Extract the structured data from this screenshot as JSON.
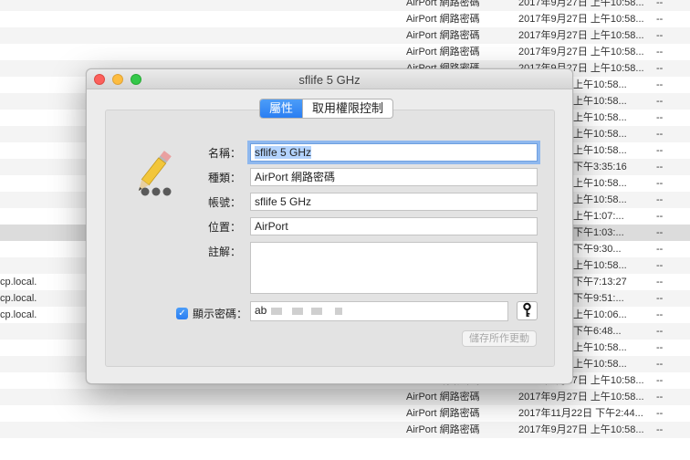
{
  "window": {
    "title": "sflife 5 GHz",
    "tabs": [
      "屬性",
      "取用權限控制"
    ],
    "labels": {
      "name": "名稱：",
      "kind": "種類：",
      "account": "帳號：",
      "where": "位置：",
      "comments": "註解："
    },
    "fields": {
      "name": "sflife 5 GHz",
      "kind": "AirPort 網路密碼",
      "account": "sflife 5 GHz",
      "where": "AirPort",
      "comments": ""
    },
    "show_password": {
      "label": "顯示密碼：",
      "checked": true,
      "check_glyph": "✓"
    },
    "password_visible": "ab",
    "save_button": "儲存所作更動",
    "key_icon": "key-icon",
    "note_icon": "pencil-note-icon"
  },
  "background_list": [
    {
      "left": "",
      "kind": "AirPort 網路密碼",
      "date": "2017年9月27日 上午10:58...",
      "size": "--",
      "style": "alt"
    },
    {
      "left": "",
      "kind": "AirPort 網路密碼",
      "date": "2017年9月27日 上午10:58...",
      "size": "--",
      "style": ""
    },
    {
      "left": "",
      "kind": "AirPort 網路密碼",
      "date": "2017年9月27日 上午10:58...",
      "size": "--",
      "style": "alt"
    },
    {
      "left": "",
      "kind": "AirPort 網路密碼",
      "date": "2017年9月27日 上午10:58...",
      "size": "--",
      "style": ""
    },
    {
      "left": "",
      "kind": "AirPort 網路密碼",
      "date": "2017年9月27日 上午10:58...",
      "size": "--",
      "style": "alt"
    },
    {
      "left": "",
      "kind": "",
      "date": "上午10:58...",
      "size": "--",
      "style": ""
    },
    {
      "left": "",
      "kind": "",
      "date": "上午10:58...",
      "size": "--",
      "style": "alt"
    },
    {
      "left": "",
      "kind": "",
      "date": "上午10:58...",
      "size": "--",
      "style": ""
    },
    {
      "left": "",
      "kind": "",
      "date": "上午10:58...",
      "size": "--",
      "style": "alt"
    },
    {
      "left": "",
      "kind": "",
      "date": "上午10:58...",
      "size": "--",
      "style": ""
    },
    {
      "left": "",
      "kind": "",
      "date": "下午3:35:16",
      "size": "--",
      "style": "alt"
    },
    {
      "left": "",
      "kind": "",
      "date": "上午10:58...",
      "size": "--",
      "style": ""
    },
    {
      "left": "",
      "kind": "",
      "date": "上午10:58...",
      "size": "--",
      "style": "alt"
    },
    {
      "left": "",
      "kind": "",
      "date": "上午1:07:...",
      "size": "--",
      "style": ""
    },
    {
      "left": "",
      "kind": "",
      "date": "下午1:03:...",
      "size": "--",
      "style": "sel"
    },
    {
      "left": "",
      "kind": "",
      "date": "下午9:30...",
      "size": "--",
      "style": ""
    },
    {
      "left": "",
      "kind": "",
      "date": "上午10:58...",
      "size": "--",
      "style": "alt"
    },
    {
      "left": "cp.local.",
      "kind": "",
      "date": "下午7:13:27",
      "size": "--",
      "style": ""
    },
    {
      "left": "cp.local.",
      "kind": "",
      "date": "下午9:51:...",
      "size": "--",
      "style": "alt"
    },
    {
      "left": "cp.local.",
      "kind": "",
      "date": "上午10:06...",
      "size": "--",
      "style": ""
    },
    {
      "left": "",
      "kind": "",
      "date": "下午6:48...",
      "size": "--",
      "style": "alt"
    },
    {
      "left": "",
      "kind": "",
      "date": "上午10:58...",
      "size": "--",
      "style": ""
    },
    {
      "left": "",
      "kind": "",
      "date": "上午10:58...",
      "size": "--",
      "style": "alt"
    },
    {
      "left": "",
      "kind": "AirPort 網路密碼",
      "date": "2017年9月27日 上午10:58...",
      "size": "--",
      "style": ""
    },
    {
      "left": "",
      "kind": "AirPort 網路密碼",
      "date": "2017年9月27日 上午10:58...",
      "size": "--",
      "style": "alt"
    },
    {
      "left": "",
      "kind": "AirPort 網路密碼",
      "date": "2017年11月22日 下午2:44...",
      "size": "--",
      "style": ""
    },
    {
      "left": "",
      "kind": "AirPort 網路密碼",
      "date": "2017年9月27日 上午10:58...",
      "size": "--",
      "style": "alt"
    }
  ]
}
